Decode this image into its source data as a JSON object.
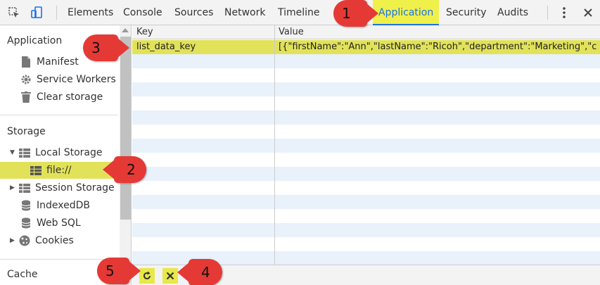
{
  "toolbar": {
    "tabs": [
      {
        "label": "Elements"
      },
      {
        "label": "Console"
      },
      {
        "label": "Sources"
      },
      {
        "label": "Network"
      },
      {
        "label": "Timeline"
      },
      {
        "label": "Application"
      },
      {
        "label": "Security"
      },
      {
        "label": "Audits"
      }
    ],
    "active_tab": "Application",
    "accent": "#1a73e8",
    "highlight": "#f0f04a"
  },
  "sidebar": {
    "application_heading": "Application",
    "application_items": [
      {
        "label": "Manifest",
        "icon": "document-icon"
      },
      {
        "label": "Service Workers",
        "icon": "gear-icon"
      },
      {
        "label": "Clear storage",
        "icon": "trash-icon"
      }
    ],
    "storage_heading": "Storage",
    "local_storage": "Local Storage",
    "local_storage_child": "file://",
    "storage_items": [
      {
        "label": "Session Storage",
        "icon": "grid-icon"
      },
      {
        "label": "IndexedDB",
        "icon": "database-icon"
      },
      {
        "label": "Web SQL",
        "icon": "database-icon"
      },
      {
        "label": "Cookies",
        "icon": "cookie-icon"
      }
    ],
    "cache_heading": "Cache"
  },
  "table": {
    "columns": [
      "Key",
      "Value"
    ],
    "rows": [
      {
        "key": "list_data_key",
        "value": "[{\"firstName\":\"Ann\",\"lastName\":\"Ricoh\",\"department\":\"Marketing\",\"city..."
      }
    ]
  },
  "callouts": [
    "1",
    "2",
    "3",
    "4",
    "5"
  ],
  "callout_color": "#e53935"
}
